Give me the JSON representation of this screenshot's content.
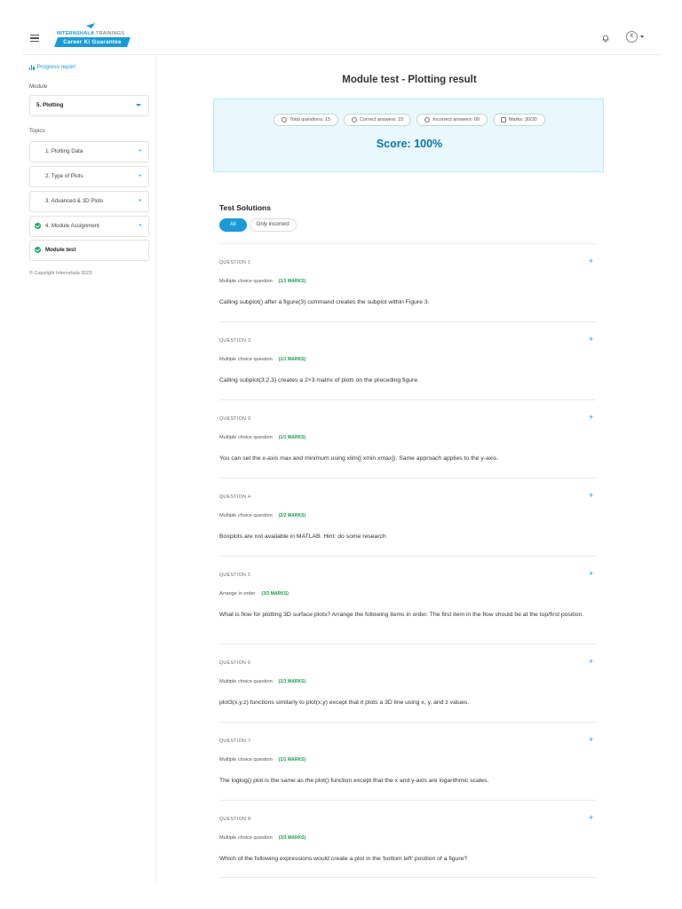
{
  "header": {
    "brand_part1": "INTERNSHALA",
    "brand_part2": " TRAININGS",
    "tagline": "Career Ki Guarantee",
    "avatar_initial": "K"
  },
  "sidebar": {
    "progress_report": "Progress report",
    "module_label": "Module",
    "module_selected": "5. Plotting",
    "topics_label": "Topics",
    "topics": [
      {
        "label": "1. Plotting Data",
        "done": false
      },
      {
        "label": "2. Type of Plots",
        "done": false
      },
      {
        "label": "3. Advanced & 3D Plots",
        "done": false
      },
      {
        "label": "4. Module Assignment",
        "done": true
      },
      {
        "label": "Module test",
        "done": true
      }
    ],
    "plus_symbol": "+",
    "copyright": "© Copyright Internshala 2023"
  },
  "main": {
    "title": "Module test - Plotting result",
    "stats": {
      "total": "Total questions: 15",
      "correct": "Correct answers: 15",
      "incorrect": "Incorrect answers: 00",
      "marks": "Marks: 30/30"
    },
    "score": "Score: 100%",
    "solutions_title": "Test Solutions",
    "filter_all": "All",
    "filter_incorrect": "Only incorrect",
    "questions": [
      {
        "num": "QUESTION 1",
        "type": "Multiple choice question",
        "marks": "(1/1 MARKS)",
        "text": "Calling subplot() after a figure(3) command creates the subplot within Figure 3."
      },
      {
        "num": "QUESTION 2",
        "type": "Multiple choice question",
        "marks": "(1/1 MARKS)",
        "text": "Calling subplot(3,2,3) creates a 2×3 matrix of plots on the preceding figure."
      },
      {
        "num": "QUESTION 3",
        "type": "Multiple choice question",
        "marks": "(1/1 MARKS)",
        "text": "You can set the x-axis max and minimum using xlim([ xmin xmax]). Same approach applies to the y-axis."
      },
      {
        "num": "QUESTION 4",
        "type": "Multiple choice question",
        "marks": "(2/2 MARKS)",
        "text": "Boxplots are not available in MATLAB. Hint: do some research"
      },
      {
        "num": "QUESTION 5",
        "type": "Arrange in order",
        "marks": "(3/3 MARKS)",
        "text": "What is flow for plotting 3D surface plots? Arrange the following items in order. The first item in the flow should be at the top/first position."
      },
      {
        "num": "QUESTION 6",
        "type": "Multiple choice question",
        "marks": "(1/1 MARKS)",
        "text": "plot3(x,y,z) functions similarly to plot(x,y) except that it plots a 3D line using x, y, and z values."
      },
      {
        "num": "QUESTION 7",
        "type": "Multiple choice question",
        "marks": "(1/1 MARKS)",
        "text": "The loglog() plot is the same as the plot() function except that the x and y-axis are logarithmic scales."
      },
      {
        "num": "QUESTION 8",
        "type": "Multiple choice question",
        "marks": "(3/3 MARKS)",
        "text": "Which of the following expressions would create a plot in the 'bottom left' position of a figure?"
      }
    ]
  }
}
